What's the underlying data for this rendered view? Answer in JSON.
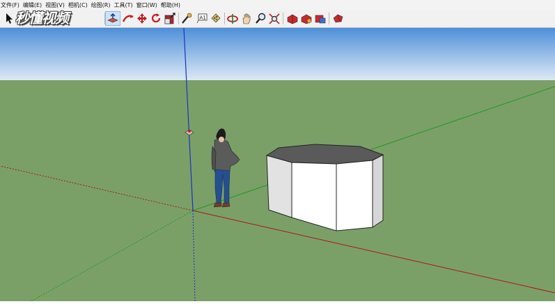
{
  "menu": {
    "items": [
      {
        "label": "文件(F)"
      },
      {
        "label": "编辑(E)"
      },
      {
        "label": "视图(V)"
      },
      {
        "label": "相机(C)"
      },
      {
        "label": "绘图(R)"
      },
      {
        "label": "工具(T)"
      },
      {
        "label": "窗口(W)"
      },
      {
        "label": "帮助(H)"
      }
    ]
  },
  "watermark": {
    "text": "秒懂视频"
  },
  "toolbar": {
    "tools": [
      "select-tool",
      "push-pull-tool",
      "follow-me-tool",
      "move-tool",
      "rotate-tool",
      "scale-tool",
      "tape-measure-tool",
      "text-tool",
      "paint-bucket-tool",
      "orbit-tool",
      "pan-tool",
      "zoom-tool",
      "zoom-extents-tool",
      "get-models-tool",
      "share-model-tool",
      "upload-component-tool",
      "extension-warehouse-tool"
    ],
    "active_tool": "push-pull-tool"
  },
  "scene": {
    "colors": {
      "sky_top": "#4e8fd8",
      "sky_bottom": "#dde9f4",
      "ground": "#7aa068",
      "axis_red": "#b01414",
      "axis_green": "#1f9a1f",
      "axis_blue": "#1a2fc8"
    }
  }
}
